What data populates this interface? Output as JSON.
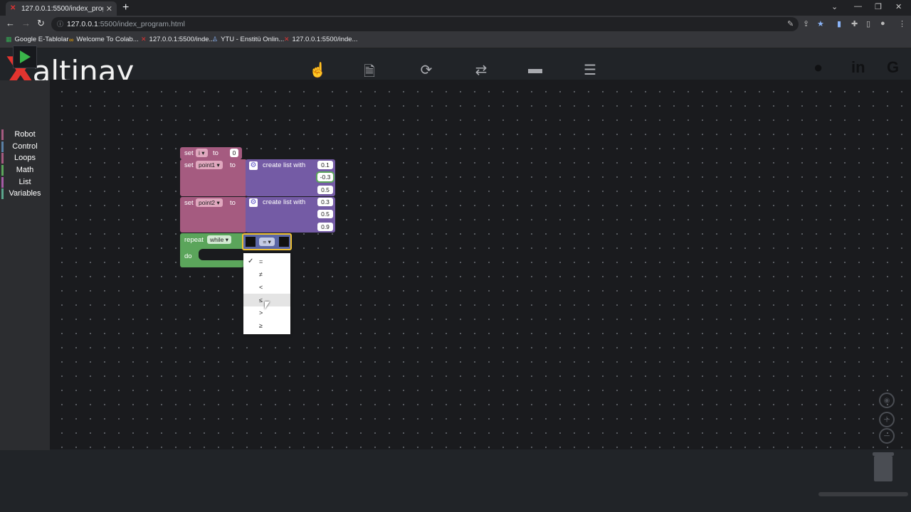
{
  "browser": {
    "tab_title": "127.0.0.1:5500/index_program.ht",
    "url_host": "127.0.0.1",
    "url_path": ":5500/index_program.html",
    "bookmarks": [
      "Google E-Tablolar",
      "Welcome To Colab...",
      "127.0.0.1:5500/inde...",
      "YTU - Enstitü Onlin...",
      "127.0.0.1:5500/inde..."
    ]
  },
  "app": {
    "logo_text": "altinay",
    "nav_icons": [
      "hand-pointer-icon",
      "file-icon",
      "refresh-icon",
      "swap-arrows-icon",
      "book-icon",
      "sliders-icon"
    ],
    "active_nav": "file-icon",
    "social_icons": [
      "github-icon",
      "linkedin-icon",
      "google-icon"
    ]
  },
  "toolbox": {
    "categories": [
      {
        "label": "Robot",
        "color": "#a55b80"
      },
      {
        "label": "Control",
        "color": "#5b80a5"
      },
      {
        "label": "Loops",
        "color": "#a55b80"
      },
      {
        "label": "Math",
        "color": "#5ba55b"
      },
      {
        "label": "List",
        "color": "#a55ba5"
      },
      {
        "label": "Variables",
        "color": "#5ba58c"
      }
    ]
  },
  "blocks": {
    "set_keyword": "set",
    "to_keyword": "to",
    "var_i": "i",
    "i_value": "0",
    "var_point1": "point1",
    "var_point2": "point2",
    "create_list": "create list with",
    "point1_values": [
      "0.1",
      "-0.3",
      "0.5"
    ],
    "point2_values": [
      "0.3",
      "0.5",
      "0.9"
    ],
    "repeat_label": "repeat",
    "while_label": "while",
    "do_label": "do",
    "compare_op": "="
  },
  "operator_dropdown": {
    "options": [
      "=",
      "≠",
      "<",
      "≤",
      ">",
      "≥"
    ],
    "selected": "=",
    "highlighted": "≤"
  },
  "colors": {
    "accent": "#e3342f",
    "variables_block": "#a55b80",
    "list_block": "#745ba5",
    "loop_block": "#5ba55b",
    "run_green": "#3ab54a"
  }
}
